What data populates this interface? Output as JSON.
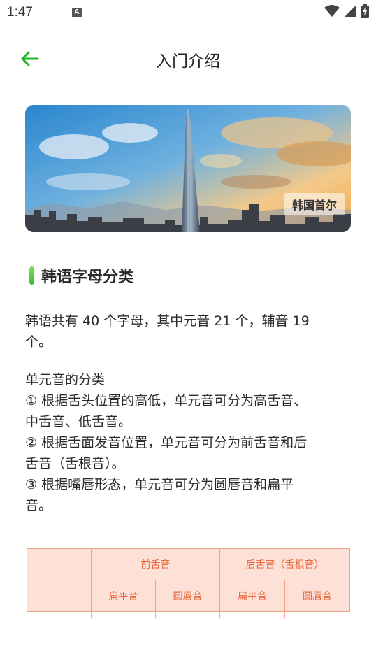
{
  "status_bar": {
    "time": "1:47",
    "notification_glyph": "A",
    "icons": [
      "wifi-icon",
      "cell-signal-icon",
      "battery-charging-icon"
    ]
  },
  "app_bar": {
    "title": "入门介绍",
    "back_icon": "arrow-left-icon",
    "accent_color": "#22b52a"
  },
  "banner": {
    "caption": "韩国首尔"
  },
  "section": {
    "title": "韩语字母分类"
  },
  "content": {
    "intro_line1": "韩语共有 40 个字母，其中元音 21 个，辅音 19",
    "intro_line2": "个。",
    "classification": [
      " 单元音的分类",
      "① 根据舌头位置的高低，单元音可分为高舌音、",
      "中舌音、低舌音。",
      "② 根据舌面发音位置，单元音可分为前舌音和后",
      "舌音（舌根音）。",
      "③ 根据嘴唇形态，单元音可分为圆唇音和扁平",
      "音。"
    ]
  },
  "table": {
    "front_header": "前舌音",
    "back_header": "后舌音（舌根音）",
    "sub_headers": [
      "扁平音",
      "圆唇音",
      "扁平音",
      "圆唇音"
    ],
    "colors": {
      "header_bg": "#fde0d6",
      "border": "#f3a183",
      "text": "#e8663c"
    }
  }
}
